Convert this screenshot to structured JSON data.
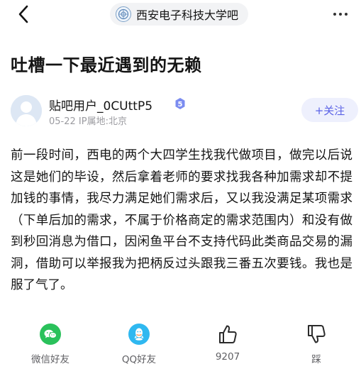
{
  "header": {
    "forum_name": "西安电子科技大学吧"
  },
  "post": {
    "title": "吐槽一下最近遇到的无赖",
    "author": {
      "name": "贴吧用户_0CUttP5",
      "level": "5",
      "meta": "05-22  IP属地:北京"
    },
    "follow_label": "+关注",
    "body": "前一段时间，西电的两个大四学生找我代做项目，做完以后说这是她们的毕设，然后拿着老师的要求找我各种加需求却不提加钱的事情，我尽力满足她们需求后，又以我没满足某项需求（下单后加的需求，不属于价格商定的需求范围内）和没有做到秒回消息为借口，因闲鱼平台不支持代码此类商品交易的漏洞，借助可以举报我为把柄反过头跟我三番五次要钱。我也是服了气了。"
  },
  "actions": {
    "wechat_label": "微信好友",
    "qq_label": "QQ好友",
    "like_count": "9207",
    "dislike_label": "踩"
  },
  "colors": {
    "accent": "#5b62e6",
    "follow_bg": "#eef0fd",
    "wechat": "#2ac15b",
    "qq": "#2fb8f0",
    "level_badge": "#7b8cf0"
  }
}
